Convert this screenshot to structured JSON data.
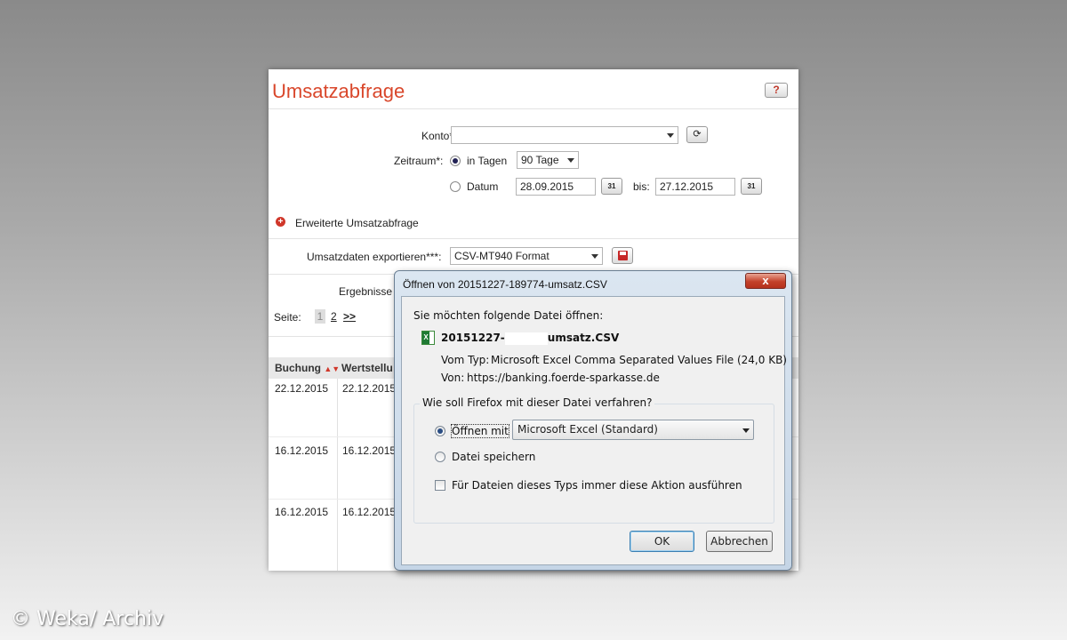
{
  "page": {
    "title": "Umsatzabfrage",
    "help_label": "?",
    "konto_label": "Konto*:",
    "konto_value": "",
    "zeitraum_label": "Zeitraum*:",
    "in_tagen_label": "in Tagen",
    "tage_value": "90 Tage",
    "datum_label": "Datum",
    "date_from": "28.09.2015",
    "bis_label": "bis:",
    "date_to": "27.12.2015",
    "erweitert_label": "Erweiterte Umsatzabfrage",
    "export_label": "Umsatzdaten exportieren***:",
    "export_value": "CSV-MT940 Format",
    "ergebnisse_label": "Ergebnisse",
    "seite_label": "Seite:",
    "pages": [
      "1",
      "2",
      ">>"
    ],
    "columns": [
      "Buchung",
      "Wertstellu"
    ],
    "rows": [
      {
        "buchung": "22.12.2015",
        "wert": "22.12.2015"
      },
      {
        "buchung": "16.12.2015",
        "wert": "16.12.2015"
      },
      {
        "buchung": "16.12.2015",
        "wert": "16.12.2015"
      }
    ]
  },
  "dialog": {
    "title": "Öffnen von 20151227-189774-umsatz.CSV",
    "close_label": "x",
    "prompt": "Sie möchten folgende Datei öffnen:",
    "file_prefix": "20151227-",
    "file_suffix": "umsatz.CSV",
    "type_label": "Vom Typ:",
    "type_value": "Microsoft Excel Comma Separated Values File (24,0 KB)",
    "from_label": "Von:",
    "from_value": "https://banking.foerde-sparkasse.de",
    "group_title": "Wie soll Firefox mit dieser Datei verfahren?",
    "open_with_label": "Öffnen mit",
    "open_with_value": "Microsoft Excel (Standard)",
    "save_label": "Datei speichern",
    "always_label": "Für Dateien dieses Typs immer diese Aktion ausführen",
    "ok_label": "OK",
    "cancel_label": "Abbrechen"
  },
  "watermark": "© Weka/ Archiv"
}
